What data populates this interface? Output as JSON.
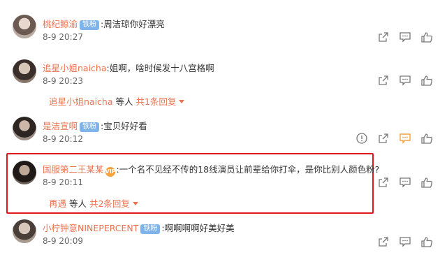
{
  "colors": {
    "username": "#eb7350",
    "badge_bg": "#7eb4eb",
    "highlight_border": "#e0191e",
    "active_icon": "#f7a23b"
  },
  "comments": [
    {
      "username": "桃纪鲸渝",
      "badge": "铁粉",
      "text": ":周洁琼你好漂亮",
      "time": "8-9 20:27"
    },
    {
      "username": "追星小姐naicha",
      "text": ":姐啊，啥时候发十八宫格啊",
      "time": "8-9 20:23",
      "replies": {
        "replier": "追星小姐naicha",
        "mid": " 等人 ",
        "count": "共1条回复"
      }
    },
    {
      "username": "是洁宣啊",
      "badge": "铁粉",
      "text": ":宝贝好好看",
      "time": "8-9 20:12"
    },
    {
      "username": "国服第二王某某",
      "vip": "VIP",
      "text": ":一个名不见经不传的18线演员让前辈给你打伞，是你比别人颜色粉?",
      "time": "8-9 20:11",
      "replies": {
        "replier": "再遇",
        "mid": " 等人 ",
        "count": "共2条回复"
      }
    },
    {
      "username": "小柠钟意NINEPERCENT",
      "badge": "铁粉",
      "text": ":啊啊啊啊好美好美",
      "time": "8-9 20:09"
    }
  ],
  "icons": [
    "report-icon",
    "share-icon",
    "comment-icon",
    "like-icon"
  ]
}
